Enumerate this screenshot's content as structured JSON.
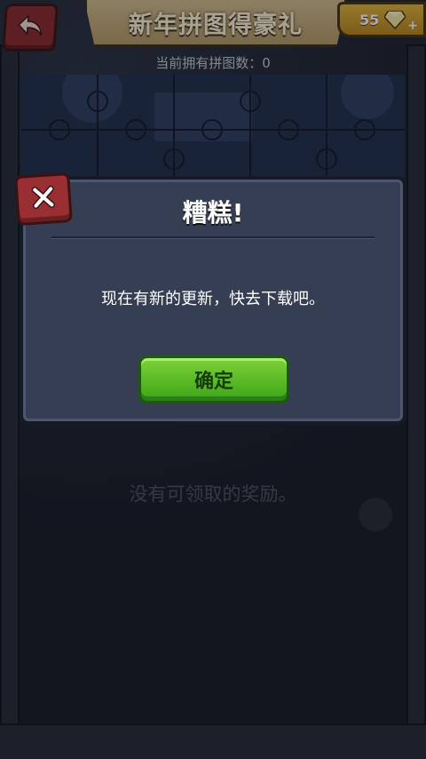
{
  "header": {
    "title": "新年拼图得豪礼",
    "gem_count": "55"
  },
  "puzzle": {
    "count_text": "当前拥有拼图数：0"
  },
  "rewards": {
    "empty_text": "没有可领取的奖励。"
  },
  "dialog": {
    "title": "糟糕!",
    "message": "现在有新的更新，快去下载吧。",
    "confirm_label": "确定"
  },
  "colors": {
    "panel": "#363e54",
    "confirm_green": "#3aa516",
    "close_red": "#9a2f33",
    "banner_tan": "#d2bd8f",
    "gem_gold": "#e2b53a"
  },
  "icons": {
    "back": "back-arrow-icon",
    "close": "close-x-icon",
    "gem": "gem-icon",
    "plus": "plus-icon"
  }
}
